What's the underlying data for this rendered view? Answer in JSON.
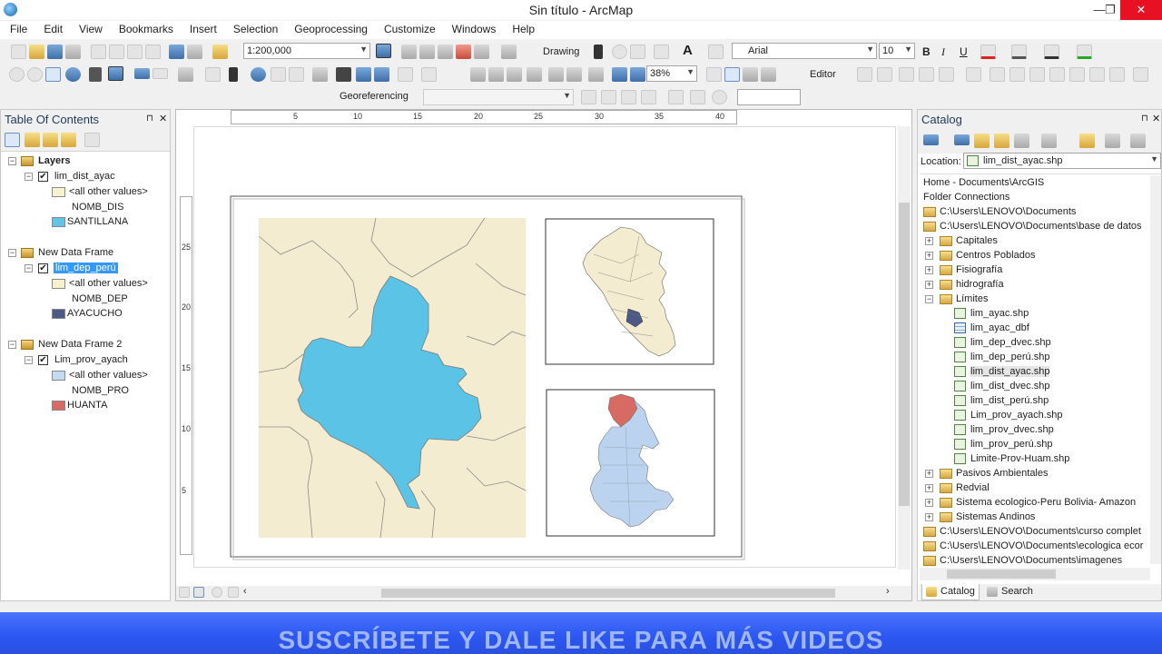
{
  "window": {
    "title": "Sin título - ArcMap",
    "minimize": "—",
    "maximize": "❐",
    "close": "✕"
  },
  "menu": [
    "File",
    "Edit",
    "View",
    "Bookmarks",
    "Insert",
    "Selection",
    "Geoprocessing",
    "Customize",
    "Windows",
    "Help"
  ],
  "toolbar": {
    "scale": "1:200,000",
    "drawing_label": "Drawing",
    "font": "Arial",
    "font_size": "10",
    "bold": "B",
    "italic": "I",
    "underline": "U",
    "text_tool": "A",
    "zoom_percent": "38%",
    "editor_label": "Editor",
    "georef_label": "Georeferencing"
  },
  "toc": {
    "title": "Table Of Contents",
    "pin": "⊓",
    "close": "✕",
    "frames": [
      {
        "name": "Layers",
        "layer": "lim_dist_ayac",
        "other": "<all other values>",
        "field": "NOMB_DIS",
        "value": "SANTILLANA",
        "other_color": "#f6f1cf",
        "value_color": "#5fc4e8"
      },
      {
        "name": "New Data Frame",
        "layer": "lim_dep_perú",
        "other": "<all other values>",
        "field": "NOMB_DEP",
        "value": "AYACUCHO",
        "other_color": "#f6f1cf",
        "value_color": "#4d5a86"
      },
      {
        "name": "New Data Frame 2",
        "layer": "Lim_prov_ayach",
        "other": "<all other values>",
        "field": "NOMB_PRO",
        "value": "HUANTA",
        "other_color": "#c4d9f2",
        "value_color": "#d86a64"
      }
    ]
  },
  "ruler": {
    "h": [
      "5",
      "10",
      "15",
      "20",
      "25",
      "30",
      "35",
      "40"
    ],
    "v": [
      "25",
      "20",
      "15",
      "10",
      "5"
    ]
  },
  "map_colors": {
    "background": "#f4ecd0",
    "highlight": "#5bc3e6",
    "prov_fill": "#bcd3f0",
    "prov_highlight": "#d86a64"
  },
  "catalog": {
    "title": "Catalog",
    "location_label": "Location:",
    "location_value": "lim_dist_ayac.shp",
    "items": [
      {
        "text": "Home - Documents\\ArcGIS",
        "type": "plain"
      },
      {
        "text": "Folder Connections",
        "type": "plain"
      },
      {
        "text": "C:\\Users\\LENOVO\\Documents",
        "type": "folder"
      },
      {
        "text": "C:\\Users\\LENOVO\\Documents\\base de datos",
        "type": "folder"
      },
      {
        "text": "Capitales",
        "type": "subfolder"
      },
      {
        "text": "Centros Poblados",
        "type": "subfolder"
      },
      {
        "text": "Fisiografía",
        "type": "subfolder"
      },
      {
        "text": "hidrografía",
        "type": "subfolder"
      },
      {
        "text": "Límites",
        "type": "subfolder-open"
      },
      {
        "text": "lim_ayac.shp",
        "type": "shp"
      },
      {
        "text": "lim_ayac_dbf",
        "type": "dbf"
      },
      {
        "text": "lim_dep_dvec.shp",
        "type": "shp"
      },
      {
        "text": "lim_dep_perú.shp",
        "type": "shp"
      },
      {
        "text": "lim_dist_ayac.shp",
        "type": "shp-selected"
      },
      {
        "text": "lim_dist_dvec.shp",
        "type": "shp"
      },
      {
        "text": "lim_dist_perú.shp",
        "type": "shp"
      },
      {
        "text": "Lim_prov_ayach.shp",
        "type": "shp"
      },
      {
        "text": "lim_prov_dvec.shp",
        "type": "shp"
      },
      {
        "text": "lim_prov_perú.shp",
        "type": "shp"
      },
      {
        "text": "Limite-Prov-Huam.shp",
        "type": "shp"
      },
      {
        "text": "Pasivos Ambientales",
        "type": "subfolder"
      },
      {
        "text": "Redvial",
        "type": "subfolder"
      },
      {
        "text": "Sistema ecologico-Peru Bolivia- Amazon",
        "type": "subfolder"
      },
      {
        "text": "Sistemas Andinos",
        "type": "subfolder"
      },
      {
        "text": "C:\\Users\\LENOVO\\Documents\\curso complet",
        "type": "folder"
      },
      {
        "text": "C:\\Users\\LENOVO\\Documents\\ecologica ecor",
        "type": "folder"
      },
      {
        "text": "C:\\Users\\LENOVO\\Documents\\imagenes",
        "type": "folder"
      }
    ],
    "tab_catalog": "Catalog",
    "tab_search": "Search"
  },
  "banner": "SUSCRÍBETE Y DALE LIKE PARA MÁS VIDEOS"
}
